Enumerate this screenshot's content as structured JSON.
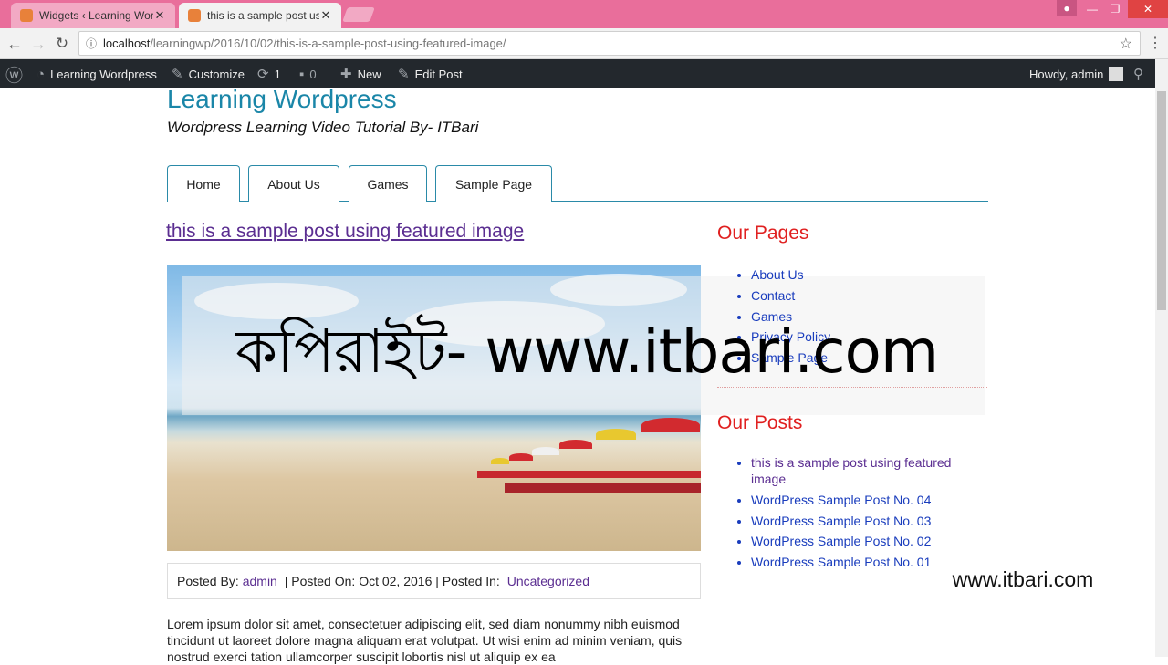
{
  "browser": {
    "tabs": [
      {
        "label": "Widgets ‹ Learning Word",
        "active": false
      },
      {
        "label": "this is a sample post usin",
        "active": true
      }
    ],
    "url_host": "localhost",
    "url_path": "/learningwp/2016/10/02/this-is-a-sample-post-using-featured-image/"
  },
  "adminbar": {
    "site_name": "Learning Wordpress",
    "customize": "Customize",
    "updates_count": "1",
    "comments_count": "0",
    "new_label": "New",
    "edit_post": "Edit Post",
    "howdy": "Howdy, admin"
  },
  "site": {
    "title": "Learning Wordpress",
    "description": "Wordpress Learning Video Tutorial By- ITBari"
  },
  "nav": [
    "Home",
    "About Us",
    "Games",
    "Sample Page"
  ],
  "post": {
    "title": "this is a sample post using featured image",
    "meta_posted_by": "Posted By: ",
    "meta_author": "admin",
    "meta_posted_on": " | Posted On: Oct 02, 2016 | Posted In: ",
    "meta_category": "Uncategorized",
    "excerpt": "Lorem ipsum dolor sit amet, consectetuer adipiscing elit, sed diam nonummy nibh euismod tincidunt ut laoreet dolore magna aliquam erat volutpat. Ut wisi enim ad minim veniam, quis nostrud exerci tation ullamcorper suscipit lobortis nisl ut aliquip ex ea"
  },
  "sidebar": {
    "pages_title": "Our Pages",
    "pages": [
      "About Us",
      "Contact",
      "Games",
      "Privacy Policy",
      "Sample Page"
    ],
    "posts_title": "Our Posts",
    "posts": [
      "this is a sample post using featured image",
      "WordPress Sample Post No. 04",
      "WordPress Sample Post No. 03",
      "WordPress Sample Post No. 02",
      "WordPress Sample Post No. 01"
    ]
  },
  "watermark": {
    "main": "কপিরাইট- www.itbari.com",
    "corner": "www.itbari.com"
  }
}
